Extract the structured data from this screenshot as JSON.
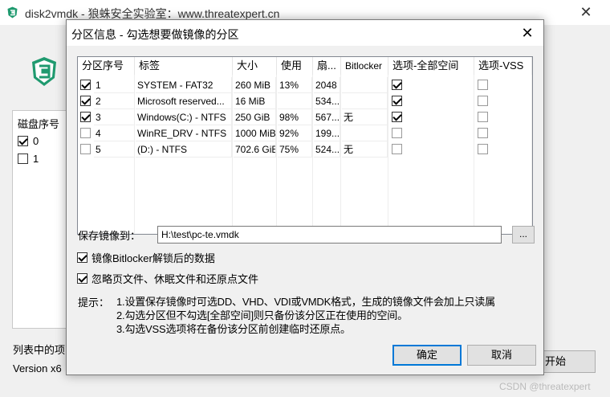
{
  "main": {
    "title": "disk2vmdk - 狼蛛安全实验室：www.threatexpert.cn",
    "close_glyph": "✕",
    "list_header": "磁盘序号",
    "disks": [
      {
        "label": "0",
        "checked": true
      },
      {
        "label": "1",
        "checked": false
      }
    ],
    "status_line": "列表中的项",
    "version_text": "Version x6",
    "start_button": "开始",
    "watermark": "CSDN @threatexpert",
    "colors": {
      "logo_green": "#1f9a6f"
    }
  },
  "dialog": {
    "title": "分区信息 - 勾选想要做镜像的分区",
    "close_glyph": "✕",
    "columns": [
      "分区序号",
      "标签",
      "大小",
      "使用",
      "扇...",
      "Bitlocker",
      "选项-全部空间",
      "选项-VSS"
    ],
    "rows": [
      {
        "checked": true,
        "num": "1",
        "label": "SYSTEM - FAT32",
        "size": "260 MiB",
        "used": "13%",
        "sector": "2048",
        "bitlocker": "",
        "full_space": true,
        "vss": false
      },
      {
        "checked": true,
        "num": "2",
        "label": "Microsoft reserved...",
        "size": "16 MiB",
        "used": "",
        "sector": "534...",
        "bitlocker": "",
        "full_space": true,
        "vss": false
      },
      {
        "checked": true,
        "num": "3",
        "label": "Windows(C:) - NTFS",
        "size": "250 GiB",
        "used": "98%",
        "sector": "567...",
        "bitlocker": "无",
        "full_space": true,
        "vss": false
      },
      {
        "checked": false,
        "num": "4",
        "label": "WinRE_DRV - NTFS",
        "size": "1000 MiB",
        "used": "92%",
        "sector": "199...",
        "bitlocker": "",
        "full_space": false,
        "vss": false
      },
      {
        "checked": false,
        "num": "5",
        "label": "(D:) - NTFS",
        "size": "702.6 GiB",
        "used": "75%",
        "sector": "524...",
        "bitlocker": "无",
        "full_space": false,
        "vss": false
      }
    ],
    "save_label": "保存镜像到：",
    "save_path": "H:\\test\\pc-te.vmdk",
    "browse_label": "...",
    "option_bitlocker": {
      "label": "镜像Bitlocker解锁后的数据",
      "checked": true
    },
    "option_ignore": {
      "label": "忽略页文件、休眠文件和还原点文件",
      "checked": true
    },
    "tips_label": "提示：",
    "tips": [
      "1.设置保存镜像时可选DD、VHD、VDI或VMDK格式，生成的镜像文件会加上只读属",
      "2.勾选分区但不勾选[全部空间]则只备份该分区正在使用的空间。",
      "3.勾选VSS选项将在备份该分区前创建临时还原点。"
    ],
    "ok_button": "确定",
    "cancel_button": "取消"
  }
}
